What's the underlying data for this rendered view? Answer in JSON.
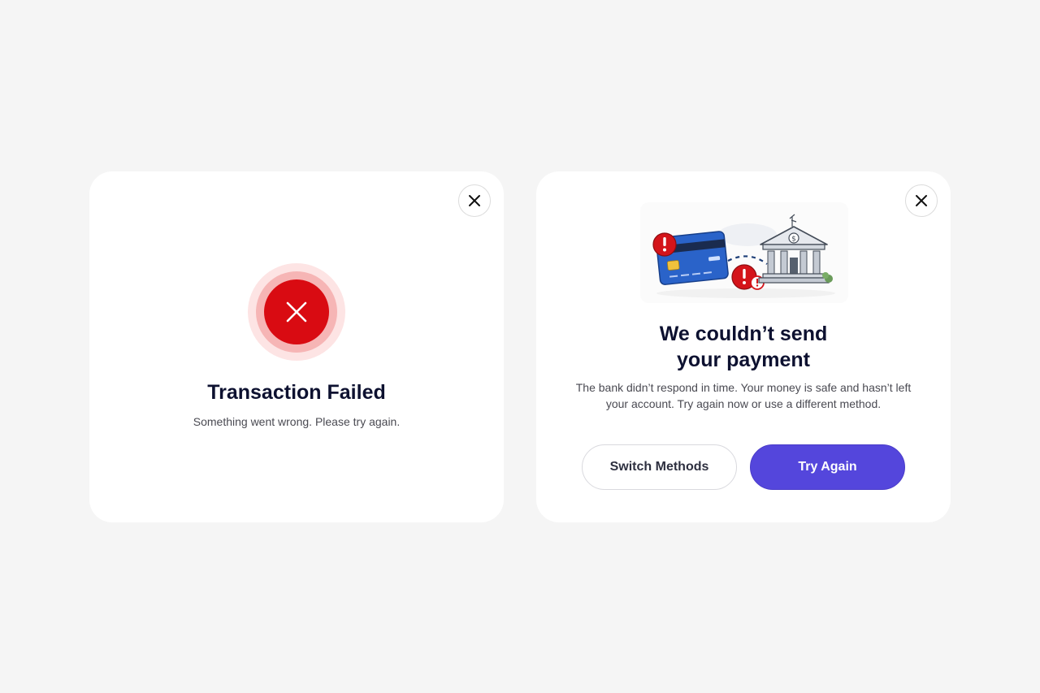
{
  "colors": {
    "page_bg": "#f5f5f5",
    "card_bg": "#ffffff",
    "error_red": "#d90b12",
    "primary": "#5446dc",
    "title_text": "#0d1130"
  },
  "left_card": {
    "close_icon": "close-icon",
    "status_icon": "error-x-icon",
    "title": "Transaction Failed",
    "subtitle": "Something went wrong. Please try again."
  },
  "right_card": {
    "close_icon": "close-icon",
    "illustration": "credit-card-to-bank-error-illustration",
    "title_line1": "We couldn’t send",
    "title_line2": "your payment",
    "description": "The bank didn’t respond in time. Your money is safe and hasn’t left your account. Try again now or use a different method.",
    "secondary_button": "Switch Methods",
    "primary_button": "Try Again"
  }
}
